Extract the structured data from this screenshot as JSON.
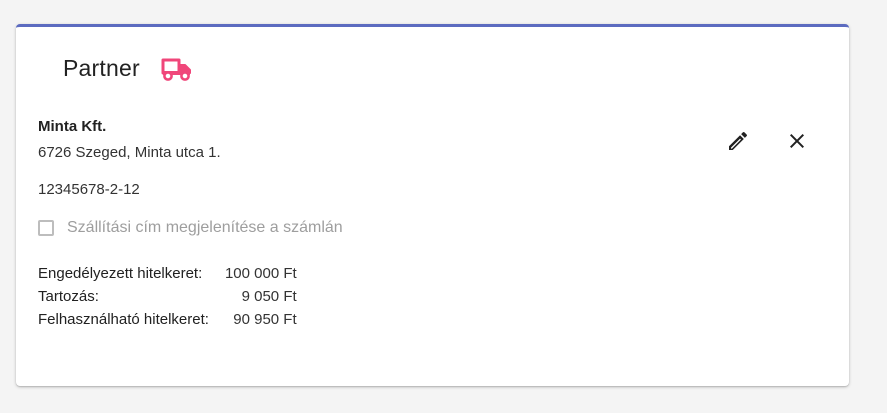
{
  "card": {
    "title": "Partner",
    "icon": "truck-icon",
    "accent_color": "#5c6bc0",
    "icon_color": "#f0467a"
  },
  "partner": {
    "name": "Minta Kft.",
    "address": "6726 Szeged, Minta utca 1.",
    "tax_number": "12345678-2-12"
  },
  "checkbox": {
    "label": "Szállítási cím megjelenítése a számlán",
    "checked": false
  },
  "credit": {
    "rows": [
      {
        "label": "Engedélyezett hitelkeret:",
        "value": "100 000 Ft"
      },
      {
        "label": "Tartozás:",
        "value": "9 050 Ft"
      },
      {
        "label": "Felhasználható hitelkeret:",
        "value": "90 950 Ft"
      }
    ]
  },
  "actions": {
    "edit_icon": "pencil-icon",
    "close_icon": "close-icon"
  }
}
